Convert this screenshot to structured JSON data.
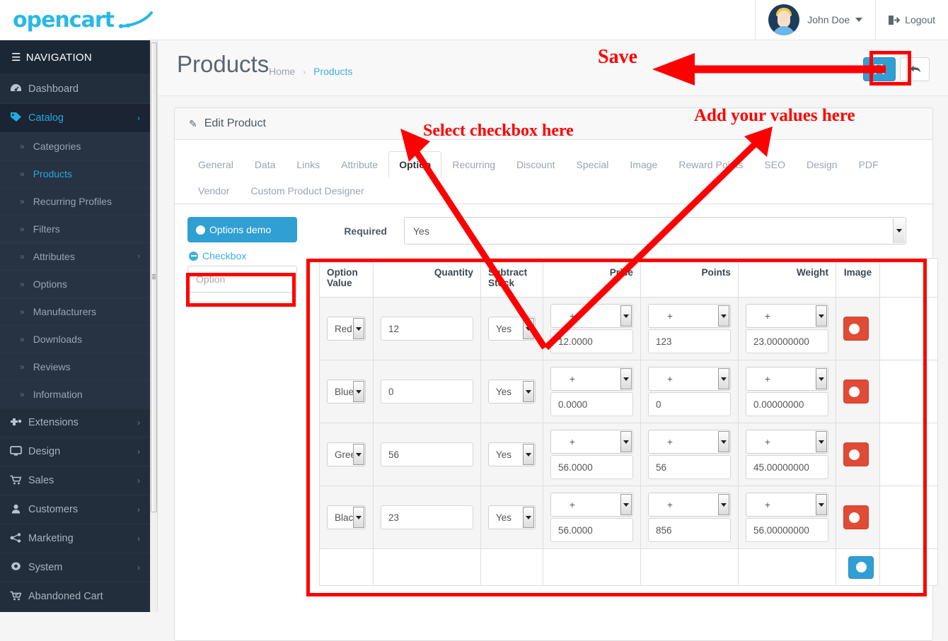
{
  "brand": {
    "logo_text": "opencart",
    "accent": "#29b8e5"
  },
  "topbar": {
    "user_name": "John Doe",
    "logout_label": "Logout"
  },
  "sidebar": {
    "heading": "NAVIGATION",
    "items": [
      {
        "label": "Dashboard",
        "icon": "dashboard-icon",
        "arrow": ""
      },
      {
        "label": "Catalog",
        "icon": "tag-icon",
        "arrow": "›"
      },
      {
        "label": "Extensions",
        "icon": "puzzle-icon",
        "arrow": "›"
      },
      {
        "label": "Design",
        "icon": "monitor-icon",
        "arrow": "›"
      },
      {
        "label": "Sales",
        "icon": "cart-icon",
        "arrow": "›"
      },
      {
        "label": "Customers",
        "icon": "user-icon",
        "arrow": "›"
      },
      {
        "label": "Marketing",
        "icon": "share-icon",
        "arrow": "›"
      },
      {
        "label": "System",
        "icon": "gear-icon",
        "arrow": "›"
      },
      {
        "label": "Abandoned Cart",
        "icon": "cart-check-icon",
        "arrow": ""
      }
    ],
    "catalog_children": [
      {
        "label": "Categories",
        "arrow": ""
      },
      {
        "label": "Products",
        "arrow": ""
      },
      {
        "label": "Recurring Profiles",
        "arrow": ""
      },
      {
        "label": "Filters",
        "arrow": ""
      },
      {
        "label": "Attributes",
        "arrow": "›"
      },
      {
        "label": "Options",
        "arrow": ""
      },
      {
        "label": "Manufacturers",
        "arrow": ""
      },
      {
        "label": "Downloads",
        "arrow": ""
      },
      {
        "label": "Reviews",
        "arrow": ""
      },
      {
        "label": "Information",
        "arrow": ""
      }
    ]
  },
  "page": {
    "title": "Products",
    "breadcrumb_home": "Home",
    "breadcrumb_current": "Products",
    "breadcrumb_sep": "›"
  },
  "panel": {
    "header": "Edit Product",
    "tabs_row1": [
      "General",
      "Data",
      "Links",
      "Attribute",
      "Option",
      "Recurring",
      "Discount",
      "Special",
      "Image",
      "Reward Points",
      "SEO",
      "Design",
      "PDF"
    ],
    "tabs_row2": [
      "Vendor",
      "Custom Product Designer"
    ],
    "active_tab": "Option"
  },
  "options": {
    "group_button": "Options demo",
    "group_link": "Checkbox",
    "option_placeholder": "Option",
    "option_value": ""
  },
  "form": {
    "required_label": "Required",
    "required_value": "Yes"
  },
  "table": {
    "headers": [
      "Option Value",
      "Quantity",
      "Subtract Stock",
      "Price",
      "Points",
      "Weight",
      "Image",
      ""
    ],
    "header_option_value_l1": "Option",
    "header_option_value_l2": "Value",
    "header_subtract_l1": "Subtract",
    "header_subtract_l2": "Stock",
    "rows": [
      {
        "option_value": "Red",
        "quantity": "12",
        "subtract_stock": "Yes",
        "price_prefix": "+",
        "price": "12.0000",
        "points_prefix": "+",
        "points": "123",
        "weight_prefix": "+",
        "weight": "23.00000000"
      },
      {
        "option_value": "Blue",
        "quantity": "0",
        "subtract_stock": "Yes",
        "price_prefix": "+",
        "price": "0.0000",
        "points_prefix": "+",
        "points": "0",
        "weight_prefix": "+",
        "weight": "0.00000000"
      },
      {
        "option_value": "Green",
        "quantity": "56",
        "subtract_stock": "Yes",
        "price_prefix": "+",
        "price": "56.0000",
        "points_prefix": "+",
        "points": "56",
        "weight_prefix": "+",
        "weight": "45.00000000"
      },
      {
        "option_value": "Black",
        "quantity": "23",
        "subtract_stock": "Yes",
        "price_prefix": "+",
        "price": "56.0000",
        "points_prefix": "+",
        "points": "856",
        "weight_prefix": "+",
        "weight": "56.00000000"
      }
    ]
  },
  "annotations": {
    "save": "Save",
    "select_checkbox": "Select checkbox here",
    "add_values": "Add your values here",
    "color": "#ff0000"
  }
}
